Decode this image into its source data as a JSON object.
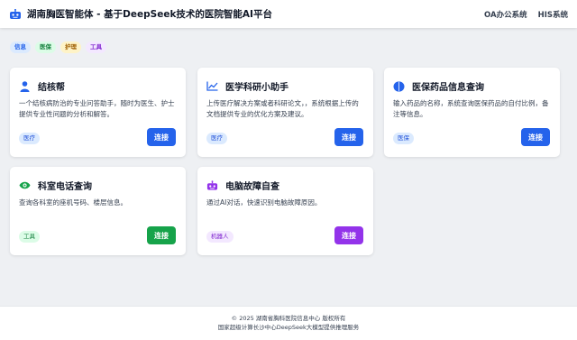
{
  "header": {
    "title": "湖南胸医智能体 - 基于DeepSeek技术的医院智能AI平台",
    "logo_icon": "robot-icon",
    "nav": [
      "OA办公系统",
      "HIS系统"
    ]
  },
  "filters": [
    {
      "label": "信息",
      "color": "#2563eb",
      "bg": "#dbeafe"
    },
    {
      "label": "医保",
      "color": "#15803d",
      "bg": "#dcfce7"
    },
    {
      "label": "护理",
      "color": "#a16207",
      "bg": "#fef3c7"
    },
    {
      "label": "工具",
      "color": "#7e22ce",
      "bg": "#f3e8ff"
    }
  ],
  "cards": [
    {
      "icon": "user-icon",
      "icon_color": "#2563eb",
      "title": "结核帮",
      "desc": "一个结核病防治的专业问答助手，随时为医生、护士提供专业性问题的分析和解答。",
      "badge": "医疗",
      "badge_color": "#1d4ed8",
      "badge_bg": "#dbeafe",
      "button": "连接",
      "button_color": "#2563eb"
    },
    {
      "icon": "chart-line-icon",
      "icon_color": "#2563eb",
      "title": "医学科研小助手",
      "desc": "上传医疗解决方案或者科研论文，，系统根据上传的文档提供专业的优化方案及建议。",
      "badge": "医疗",
      "badge_color": "#1d4ed8",
      "badge_bg": "#dbeafe",
      "button": "连接",
      "button_color": "#2563eb"
    },
    {
      "icon": "brain-icon",
      "icon_color": "#2563eb",
      "title": "医保药品信息查询",
      "desc": "输入药品的名称，系统查询医保药品的自付比例，备注等信息。",
      "badge": "医保",
      "badge_color": "#1d4ed8",
      "badge_bg": "#dbeafe",
      "button": "连接",
      "button_color": "#2563eb"
    },
    {
      "icon": "eye-icon",
      "icon_color": "#16a34a",
      "title": "科室电话查询",
      "desc": "查询各科室的座机号码、楼层信息。",
      "badge": "工具",
      "badge_color": "#15803d",
      "badge_bg": "#dcfce7",
      "button": "连接",
      "button_color": "#16a34a"
    },
    {
      "icon": "robot-icon",
      "icon_color": "#9333ea",
      "title": "电脑故障自查",
      "desc": "通过AI对话，快速识别电脑故障原因。",
      "badge": "机器人",
      "badge_color": "#7e22ce",
      "badge_bg": "#f3e8ff",
      "button": "连接",
      "button_color": "#9333ea"
    }
  ],
  "footer": {
    "line1": "© 2025 湖南省胸科医院信息中心 版权所有",
    "line2": "国家超级计算长沙中心DeepSeek大模型提供推理服务"
  }
}
